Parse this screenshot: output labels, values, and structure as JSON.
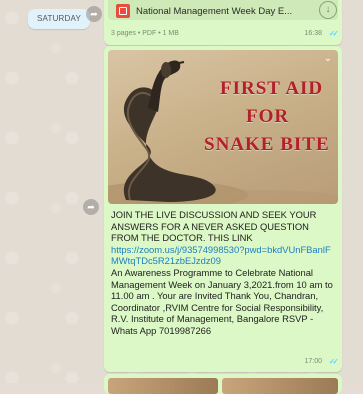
{
  "date_chip": "SATURDAY",
  "prev_message": {
    "title": "National Management Week Day E...",
    "meta": "3 pages • PDF • 1 MB",
    "time": "16:38",
    "ticks": "✓✓"
  },
  "message": {
    "image_caption": [
      "FIRST AID",
      "FOR",
      "SNAKE BITE"
    ],
    "text_intro": "JOIN THE LIVE DISCUSSION AND SEEK YOUR ANSWERS FOR A NEVER ASKED QUESTION FROM THE DOCTOR.  THIS LINK",
    "link": "https://zoom.us/j/93574998530?pwd=bkdVUnFBanlFMWtqTDc5R21zbEJzdz09",
    "text_body": "An Awareness Programme to Celebrate National Management Week on January 3,2021.from 10 am to 11.00 am . Your are Invited Thank You, Chandran, Coordinator ,RVIM Centre for Social Responsibility, R.V. Institute of Management, Bangalore  RSVP -Whats App 7019987266",
    "time": "17:00",
    "ticks": "✓✓"
  },
  "icons": {
    "forward": "forward-icon",
    "pdf": "pdf-file-icon",
    "download": "download-icon",
    "menu": "chevron-down-icon",
    "read": "double-check-icon"
  },
  "colors": {
    "bubble": "#dcf8c6",
    "link": "#1b7fc1",
    "caption": "#b3202a",
    "tick": "#4fc3f7"
  }
}
